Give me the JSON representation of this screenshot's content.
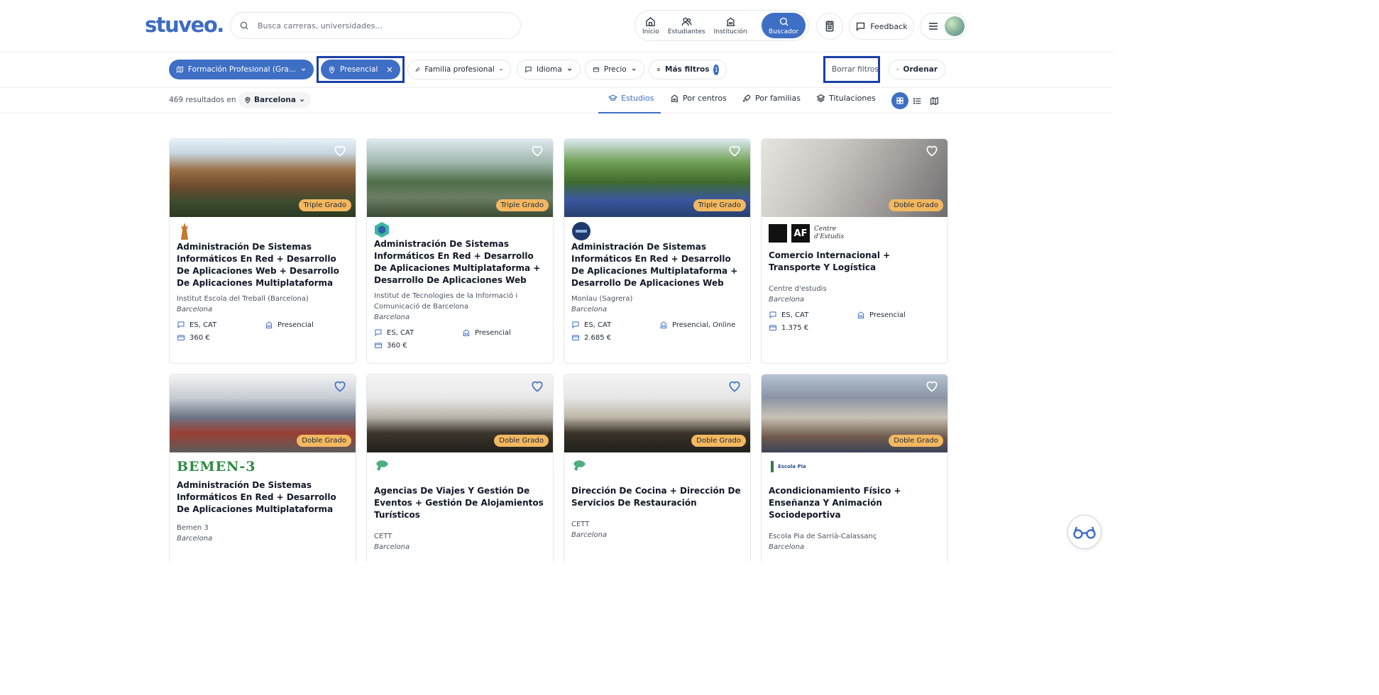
{
  "header": {
    "logo": "stuveo.",
    "search": {
      "placeholder": "Busca carreras, universidades..."
    },
    "nav": [
      {
        "label": "Inicio",
        "icon": "home-icon"
      },
      {
        "label": "Estudiantes",
        "icon": "users-icon"
      },
      {
        "label": "Institución",
        "icon": "building-icon"
      },
      {
        "label": "Buscador",
        "icon": "search-icon",
        "active": true
      }
    ],
    "feedback": "Feedback"
  },
  "filters": {
    "chips": [
      {
        "label": "Formación Profesional (Gra...",
        "icon": "map-icon",
        "type": "blue-dropdown"
      },
      {
        "label": "Presencial",
        "icon": "location-pin-icon",
        "type": "blue-removable"
      },
      {
        "label": "Familia profesional",
        "icon": "rocket-icon"
      },
      {
        "label": "Idioma",
        "icon": "chat-icon"
      },
      {
        "label": "Precio",
        "icon": "wallet-icon"
      },
      {
        "label": "Más filtros",
        "icon": "sliders-icon",
        "badge": "1"
      }
    ],
    "clear": "Borrar filtros",
    "sort": "Ordenar"
  },
  "results": {
    "count_text": "469 resultados en",
    "city": "Barcelona",
    "tabs": [
      {
        "label": "Estudios",
        "active": true
      },
      {
        "label": "Por centros"
      },
      {
        "label": "Por familias"
      },
      {
        "label": "Titulaciones"
      }
    ]
  },
  "cards": [
    {
      "tag": "Triple Grado",
      "title": "Administración De Sistemas Informáticos En Red + Desarrollo De Aplicaciones Web + Desarrollo De Aplicaciones Multiplataforma",
      "center": "Institut Escola del Treball (Barcelona)",
      "city": "Barcelona",
      "languages": "ES, CAT",
      "modality": "Presencial",
      "price": "360 €"
    },
    {
      "tag": "Triple Grado",
      "title": "Administración De Sistemas Informáticos En Red + Desarrollo De Aplicaciones Multiplataforma + Desarrollo De Aplicaciones Web",
      "center": "Institut de Tecnologies de la Informació i Comunicació de Barcelona",
      "city": "Barcelona",
      "languages": "ES, CAT",
      "modality": "Presencial",
      "price": "360 €"
    },
    {
      "tag": "Triple Grado",
      "title": "Administración De Sistemas Informáticos En Red + Desarrollo De Aplicaciones Multiplataforma + Desarrollo De Aplicaciones Web",
      "center": "Monlau (Sagrera)",
      "city": "Barcelona",
      "languages": "ES, CAT",
      "modality": "Presencial, Online",
      "price": "2.685 €"
    },
    {
      "tag": "Doble Grado",
      "title": "Comercio Internacional + Transporte Y Logística",
      "center": "Centre d'estudis",
      "city": "Barcelona",
      "languages": "ES, CAT",
      "modality": "Presencial",
      "price": "1.375 €",
      "logo_text": "Centre d'Estudis",
      "logo_mark": "AF"
    },
    {
      "tag": "Doble Grado",
      "title": "Administración De Sistemas Informáticos En Red + Desarrollo De Aplicaciones Multiplataforma",
      "center": "Bemen 3",
      "city": "Barcelona",
      "logo_text": "BEMEN-3"
    },
    {
      "tag": "Doble Grado",
      "title": "Agencias De Viajes Y Gestión De Eventos + Gestión De Alojamientos Turísticos",
      "center": "CETT",
      "city": "Barcelona"
    },
    {
      "tag": "Doble Grado",
      "title": "Dirección De Cocina + Dirección De Servicios De Restauración",
      "center": "CETT",
      "city": "Barcelona"
    },
    {
      "tag": "Doble Grado",
      "title": "Acondicionamiento Físico + Enseñanza Y Animación Sociodeportiva",
      "center": "Escola Pia de Sarrià-Calassanç",
      "city": "Barcelona",
      "logo_text": "Escola Pia"
    }
  ],
  "colors": {
    "brand": "#3e6fc4",
    "tag": "#f3b860",
    "highlight": "#1b3fa8"
  }
}
